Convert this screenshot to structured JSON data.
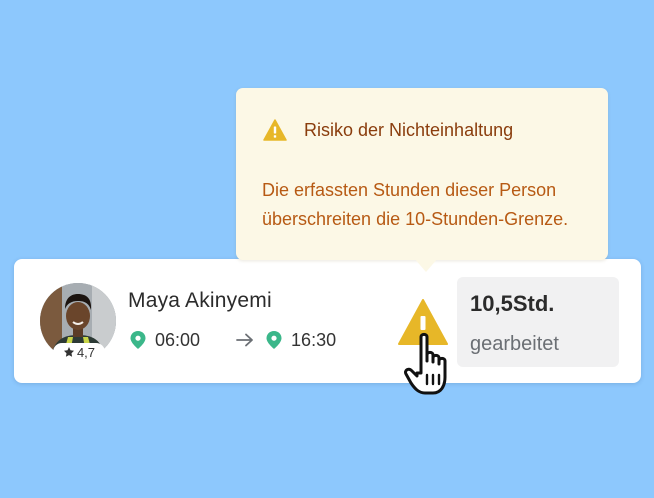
{
  "person": {
    "name": "Maya Akinyemi",
    "rating": "4,7",
    "start_time": "06:00",
    "end_time": "16:30"
  },
  "hours": {
    "value": "10,5Std.",
    "label": "gearbeitet"
  },
  "warning": {
    "title": "Risiko der Nichteinhaltung",
    "message": "Die erfassten Stunden dieser Person überschreiten die 10-Stunden-Grenze."
  },
  "colors": {
    "background": "#8dc8fd",
    "warning_icon": "#e7b728",
    "pin_icon": "#3bb78a",
    "tooltip_bg": "#fcf8e6",
    "tooltip_title": "#8a3d0d",
    "tooltip_text": "#b75a14"
  },
  "icons": {
    "star": "star-icon",
    "pin": "location-pin-icon",
    "arrow": "arrow-right-icon",
    "warning": "warning-triangle-icon",
    "cursor": "hand-pointer-cursor-icon"
  }
}
